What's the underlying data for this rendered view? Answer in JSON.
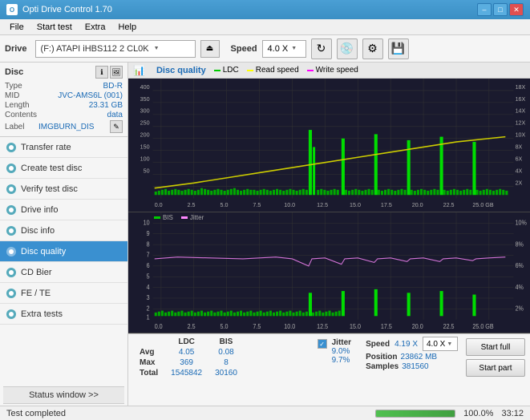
{
  "app": {
    "title": "Opti Drive Control 1.70",
    "icon": "O"
  },
  "title_buttons": {
    "minimize": "–",
    "maximize": "□",
    "close": "✕"
  },
  "menu": {
    "items": [
      "File",
      "Start test",
      "Extra",
      "Help"
    ]
  },
  "toolbar": {
    "drive_label": "Drive",
    "drive_value": "(F:)  ATAPI iHBS112  2 CL0K",
    "speed_label": "Speed",
    "speed_value": "4.0 X"
  },
  "disc": {
    "header": "Disc",
    "type_key": "Type",
    "type_val": "BD-R",
    "mid_key": "MID",
    "mid_val": "JVC-AMS6L (001)",
    "length_key": "Length",
    "length_val": "23.31 GB",
    "contents_key": "Contents",
    "contents_val": "data",
    "label_key": "Label",
    "label_val": "IMGBURN_DIS"
  },
  "nav": {
    "items": [
      {
        "id": "transfer-rate",
        "label": "Transfer rate",
        "active": false
      },
      {
        "id": "create-test-disc",
        "label": "Create test disc",
        "active": false
      },
      {
        "id": "verify-test-disc",
        "label": "Verify test disc",
        "active": false
      },
      {
        "id": "drive-info",
        "label": "Drive info",
        "active": false
      },
      {
        "id": "disc-info",
        "label": "Disc info",
        "active": false
      },
      {
        "id": "disc-quality",
        "label": "Disc quality",
        "active": true
      },
      {
        "id": "cd-bier",
        "label": "CD Bier",
        "active": false
      },
      {
        "id": "fe-te",
        "label": "FE / TE",
        "active": false
      },
      {
        "id": "extra-tests",
        "label": "Extra tests",
        "active": false
      }
    ]
  },
  "status_window": "Status window >>",
  "chart": {
    "title": "Disc quality",
    "legend_ldc": "LDC",
    "legend_read": "Read speed",
    "legend_write": "Write speed",
    "legend_bis": "BIS",
    "legend_jitter": "Jitter",
    "y_axis_top": [
      "400",
      "350",
      "300",
      "250",
      "200",
      "150",
      "100",
      "50"
    ],
    "y_axis_top_right": [
      "18X",
      "16X",
      "14X",
      "12X",
      "10X",
      "8X",
      "6X",
      "4X",
      "2X"
    ],
    "y_axis_bottom": [
      "10",
      "9",
      "8",
      "7",
      "6",
      "5",
      "4",
      "3",
      "2",
      "1"
    ],
    "y_axis_bottom_right": [
      "10%",
      "8%",
      "6%",
      "4%",
      "2%"
    ],
    "x_axis": [
      "0.0",
      "2.5",
      "5.0",
      "7.5",
      "10.0",
      "12.5",
      "15.0",
      "17.5",
      "20.0",
      "22.5",
      "25.0 GB"
    ]
  },
  "stats": {
    "columns": [
      "LDC",
      "BIS",
      "",
      "Jitter",
      "Speed",
      ""
    ],
    "avg_label": "Avg",
    "avg_ldc": "4.05",
    "avg_bis": "0.08",
    "avg_jitter": "9.0%",
    "max_label": "Max",
    "max_ldc": "369",
    "max_bis": "8",
    "max_jitter": "9.7%",
    "total_label": "Total",
    "total_ldc": "1545842",
    "total_bis": "30160",
    "speed_label": "Speed",
    "speed_val": "4.19 X",
    "speed_select": "4.0 X",
    "position_label": "Position",
    "position_val": "23862 MB",
    "samples_label": "Samples",
    "samples_val": "381560",
    "jitter_checked": true
  },
  "buttons": {
    "start_full": "Start full",
    "start_part": "Start part"
  },
  "bottom": {
    "status": "Test completed",
    "progress": 100,
    "progress_text": "100.0%",
    "time": "33:12"
  }
}
